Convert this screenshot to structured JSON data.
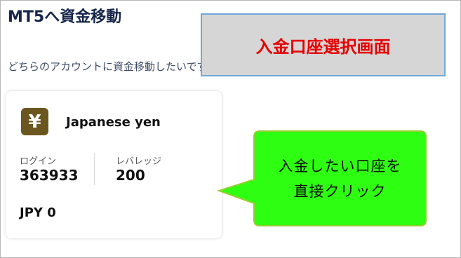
{
  "header": {
    "title": "MT5へ資金移動",
    "subtitle": "どちらのアカウントに資金移動したいですか"
  },
  "annotation_label": {
    "text": "入金口座選択画面",
    "color": "#e60000",
    "background": "#d6d6d6"
  },
  "account_card": {
    "currency_symbol": "¥",
    "currency_name": "Japanese yen",
    "login_label": "ログイン",
    "login_value": "363933",
    "leverage_label": "レバレッジ",
    "leverage_value": "200",
    "balance": "JPY 0"
  },
  "speech_bubble": {
    "line1": "入金したい口座を",
    "line2": "直接クリック",
    "fill": "#2eff12",
    "border": "#9acd32"
  }
}
